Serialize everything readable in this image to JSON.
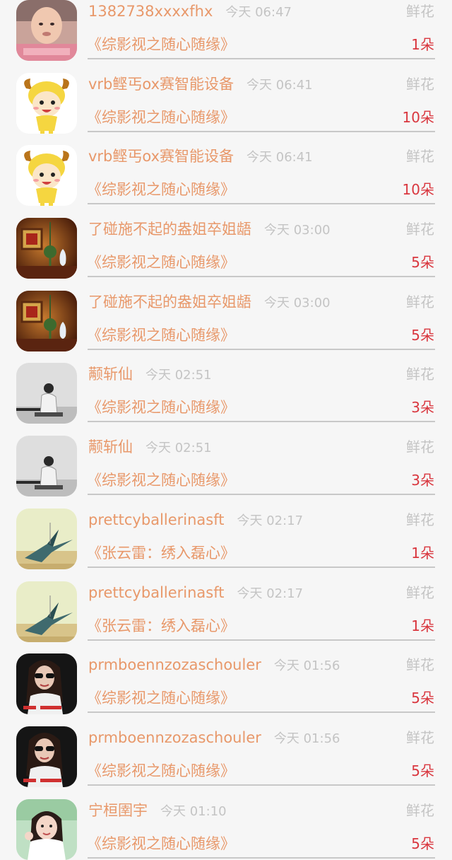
{
  "flower_label": "鲜花",
  "items": [
    {
      "name": "1382738xxxxfhx",
      "time": "今天 06:47",
      "work": "《综影视之随心随缘》",
      "count": "1朵",
      "avatar": "baby-photo"
    },
    {
      "name": "vrb鲣丐ox赛智能设备",
      "time": "今天 06:41",
      "work": "《综影视之随心随缘》",
      "count": "10朵",
      "avatar": "cartoon-goat-icon"
    },
    {
      "name": "vrb鲣丐ox赛智能设备",
      "time": "今天 06:41",
      "work": "《综影视之随心随缘》",
      "count": "10朵",
      "avatar": "cartoon-goat-icon"
    },
    {
      "name": "了碰施不起的盎姐卒姐龉",
      "time": "今天 03:00",
      "work": "《综影视之随心随缘》",
      "count": "5朵",
      "avatar": "chinese-decor-photo"
    },
    {
      "name": "了碰施不起的盎姐卒姐龉",
      "time": "今天 03:00",
      "work": "《综影视之随心随缘》",
      "count": "5朵",
      "avatar": "chinese-decor-photo"
    },
    {
      "name": "颟斩仙",
      "time": "今天 02:51",
      "work": "《综影视之随心随缘》",
      "count": "3朵",
      "avatar": "bw-person-photo"
    },
    {
      "name": "颟斩仙",
      "time": "今天 02:51",
      "work": "《综影视之随心随缘》",
      "count": "3朵",
      "avatar": "bw-person-photo"
    },
    {
      "name": "prettcyballerinasft",
      "time": "今天 02:17",
      "work": "《张云雷：绣入磊心》",
      "count": "1朵",
      "avatar": "paper-crane-photo"
    },
    {
      "name": "prettcyballerinasft",
      "time": "今天 02:17",
      "work": "《张云雷：绣入磊心》",
      "count": "1朵",
      "avatar": "paper-crane-photo"
    },
    {
      "name": "prmboennzozaschouler",
      "time": "今天 01:56",
      "work": "《综影视之随心随缘》",
      "count": "5朵",
      "avatar": "sunglasses-woman-photo"
    },
    {
      "name": "prmboennzozaschouler",
      "time": "今天 01:56",
      "work": "《综影视之随心随缘》",
      "count": "5朵",
      "avatar": "sunglasses-woman-photo"
    },
    {
      "name": "宁桓圉宇",
      "time": "今天 01:10",
      "work": "《综影视之随心随缘》",
      "count": "5朵",
      "avatar": "girl-photo"
    }
  ],
  "colors": {
    "name": "#e8986a",
    "time": "#c4c4c4",
    "count": "#d9363e",
    "separator": "#c8c8c8",
    "background": "#f6f6f6"
  }
}
